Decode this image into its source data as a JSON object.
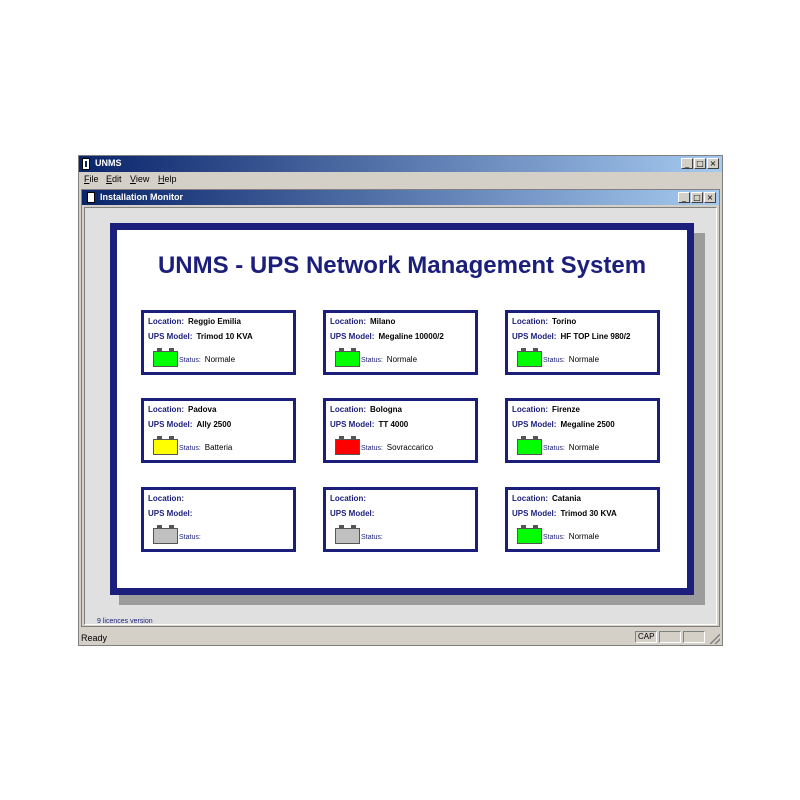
{
  "app": {
    "title": "UNMS",
    "menu": [
      "File",
      "Edit",
      "View",
      "Help"
    ],
    "window_buttons": [
      "_",
      "□",
      "×"
    ]
  },
  "child": {
    "title": "Installation Monitor",
    "window_buttons": [
      "_",
      "□",
      "×"
    ]
  },
  "panel": {
    "title": "UNMS - UPS Network Management System"
  },
  "labels": {
    "location": "Location:",
    "model": "UPS Model:",
    "status": "Status:"
  },
  "colors": {
    "accent": "#1b1e7a",
    "normal": "#00ff00",
    "battery": "#ffff00",
    "overload": "#ff0000",
    "unknown": "#c0c0c0"
  },
  "cards": [
    {
      "location": "Reggio Emilia",
      "model": "Trimod 10 KVA",
      "status": "Normale",
      "state": "normal"
    },
    {
      "location": "Milano",
      "model": "Megaline 10000/2",
      "status": "Normale",
      "state": "normal"
    },
    {
      "location": "Torino",
      "model": "HF TOP Line 980/2",
      "status": "Normale",
      "state": "normal"
    },
    {
      "location": "Padova",
      "model": "Ally 2500",
      "status": "Batteria",
      "state": "battery"
    },
    {
      "location": "Bologna",
      "model": "TT 4000",
      "status": "Sovraccarico",
      "state": "overload"
    },
    {
      "location": "Firenze",
      "model": "Megaline 2500",
      "status": "Normale",
      "state": "normal"
    },
    {
      "location": "",
      "model": "",
      "status": "",
      "state": "unknown"
    },
    {
      "location": "",
      "model": "",
      "status": "",
      "state": "unknown"
    },
    {
      "location": "Catania",
      "model": "Trimod 30 KVA",
      "status": "Normale",
      "state": "normal"
    }
  ],
  "licence": "9 licences version",
  "statusbar": {
    "ready": "Ready",
    "cap": "CAP"
  }
}
